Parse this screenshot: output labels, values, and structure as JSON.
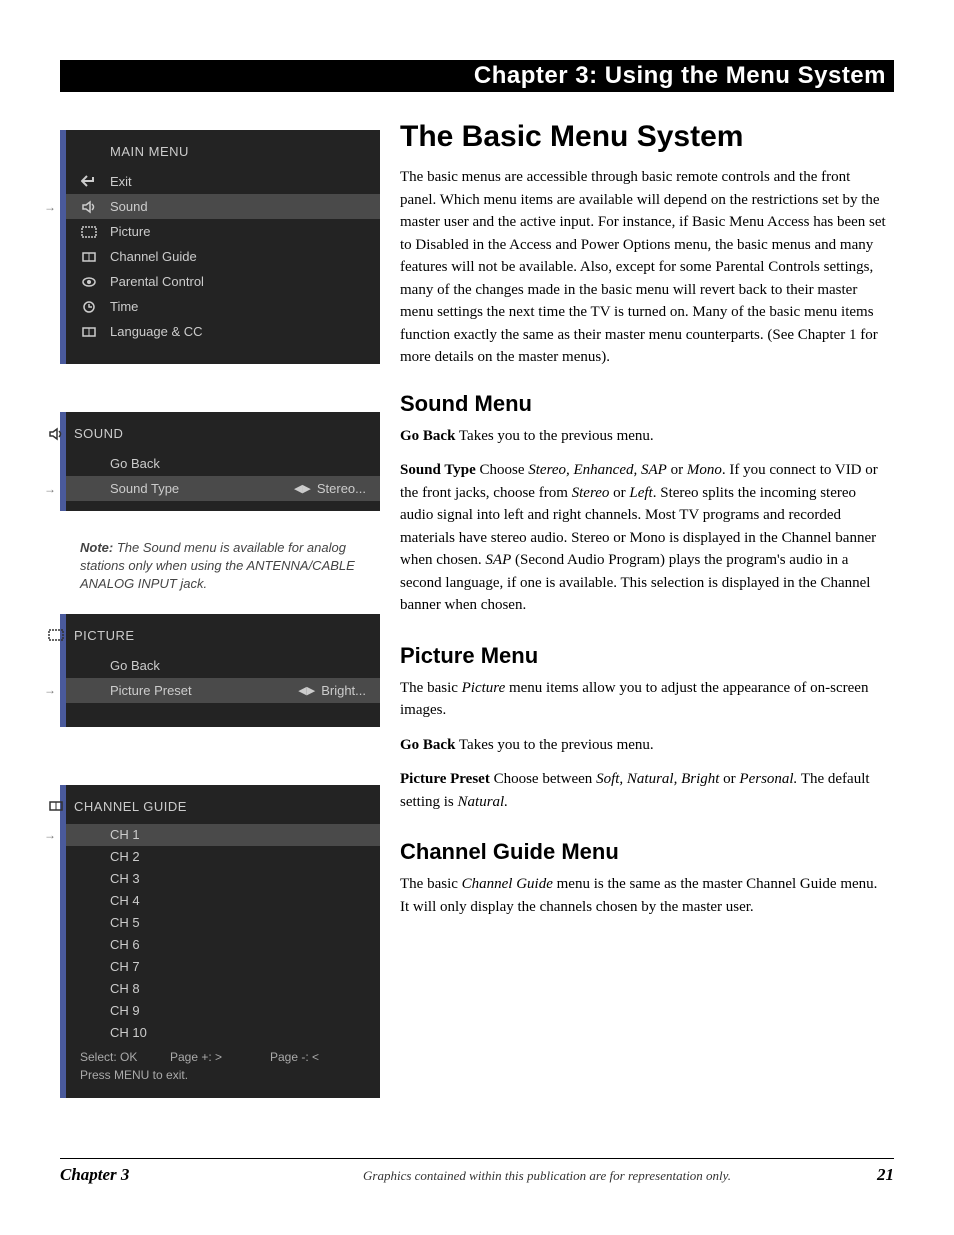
{
  "header": "Chapter 3: Using the Menu System",
  "main_menu": {
    "title": "MAIN MENU",
    "items": [
      {
        "label": "Exit",
        "icon": "back-arrow-icon"
      },
      {
        "label": "Sound",
        "icon": "sound-icon",
        "selected": true
      },
      {
        "label": "Picture",
        "icon": "picture-icon"
      },
      {
        "label": "Channel Guide",
        "icon": "guide-icon"
      },
      {
        "label": "Parental Control",
        "icon": "eye-icon"
      },
      {
        "label": "Time",
        "icon": "clock-icon"
      },
      {
        "label": "Language & CC",
        "icon": "guide-icon"
      }
    ]
  },
  "sound_panel": {
    "title": "SOUND",
    "rows": [
      {
        "label": "Go Back"
      },
      {
        "label": "Sound Type",
        "value": "Stereo...",
        "selected": true
      }
    ]
  },
  "note_text": {
    "prefix": "Note:",
    "body": " The Sound menu is available for analog stations only when using the ANTENNA/CABLE ANALOG INPUT jack."
  },
  "picture_panel": {
    "title": "PICTURE",
    "rows": [
      {
        "label": "Go Back"
      },
      {
        "label": "Picture Preset",
        "value": "Bright...",
        "selected": true
      }
    ]
  },
  "channel_panel": {
    "title": "CHANNEL GUIDE",
    "channels": [
      "CH 1",
      "CH 2",
      "CH 3",
      "CH 4",
      "CH 5",
      "CH 6",
      "CH 7",
      "CH 8",
      "CH 9",
      "CH 10"
    ],
    "hint1_a": "Select: OK",
    "hint1_b": "Page +: >",
    "hint1_c": "Page -: <",
    "hint2": "Press MENU to exit."
  },
  "article": {
    "h1": "The Basic Menu System",
    "intro": "The basic menus are accessible through basic remote controls and the front panel. Which menu items are available will depend on the restrictions set by the master user and the active input. For instance, if Basic Menu Access has been set to Disabled in the Access and Power Options menu, the basic menus and many features will not be available. Also, except for some Parental Controls settings, many of the changes made in the basic menu will revert back to their master menu settings the next time the TV is turned on. Many of the basic menu items function exactly the same as their master menu counterparts. (See Chapter 1 for more details on the master menus).",
    "sound_h": "Sound Menu",
    "sound_goback_term": "Go Back",
    "sound_goback_body": "   Takes you to the previous menu.",
    "sound_type_term": "Sound Type",
    "sound_type_pre": "     Choose ",
    "sound_type_em1": "Stereo, Enhanced, SAP",
    "sound_type_mid": " or ",
    "sound_type_em2": "Mono",
    "sound_type_post": ". If you connect to VID or the front jacks, choose from ",
    "sound_type_em3": "Stereo",
    "sound_type_mid2": " or ",
    "sound_type_em4": "Left",
    "sound_type_tail": ". Stereo splits the incoming stereo audio signal into left and right channels. Most TV programs and recorded materials have stereo audio. Stereo or Mono is displayed in the Channel banner when chosen. ",
    "sound_type_em5": "SAP",
    "sound_type_tail2": " (Second Audio Program) plays the program's audio in a second language, if one is available. This selection is displayed in the Channel banner when chosen.",
    "picture_h": "Picture Menu",
    "picture_intro_pre": "The basic ",
    "picture_intro_em": "Picture",
    "picture_intro_post": " menu items allow you to adjust the appearance of on-screen images.",
    "picture_goback_term": "Go Back",
    "picture_goback_body": "   Takes you to the previous menu.",
    "picture_preset_term": "Picture Preset",
    "picture_preset_pre": "    Choose between ",
    "picture_preset_em1": "Soft, Natural, Bright",
    "picture_preset_mid": " or ",
    "picture_preset_em2": "Personal.",
    "picture_preset_post": " The default setting is ",
    "picture_preset_em3": "Natural.",
    "channel_h": "Channel Guide Menu",
    "channel_body_pre": "The basic ",
    "channel_body_em": "Channel Guide",
    "channel_body_post": " menu is the same as the master Channel Guide menu. It will only display the channels chosen by the master user."
  },
  "footer": {
    "chapter": "Chapter 3",
    "disclaimer": "Graphics contained within this publication are for representation only.",
    "page": "21"
  }
}
